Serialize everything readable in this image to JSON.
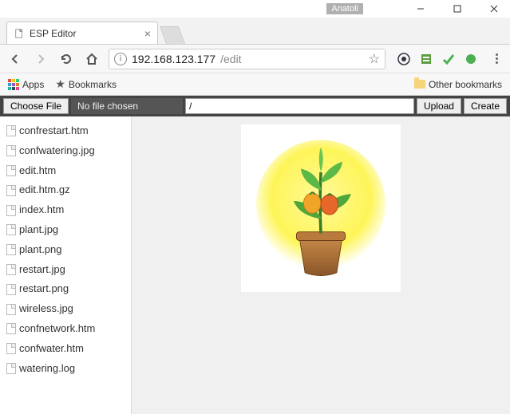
{
  "window": {
    "user_badge": "Anatoli"
  },
  "tab": {
    "title": "ESP Editor"
  },
  "omnibox": {
    "host": "192.168.123.177",
    "path": "/edit"
  },
  "bookmarks": {
    "apps_label": "Apps",
    "bookmarks_label": "Bookmarks",
    "other_label": "Other bookmarks"
  },
  "editor_bar": {
    "choose_file_label": "Choose File",
    "file_status": "No file chosen",
    "path_value": "/",
    "upload_label": "Upload",
    "create_label": "Create"
  },
  "files": [
    "confrestart.htm",
    "confwatering.jpg",
    "edit.htm",
    "edit.htm.gz",
    "index.htm",
    "plant.jpg",
    "plant.png",
    "restart.jpg",
    "restart.png",
    "wireless.jpg",
    "confnetwork.htm",
    "confwater.htm",
    "watering.log"
  ]
}
